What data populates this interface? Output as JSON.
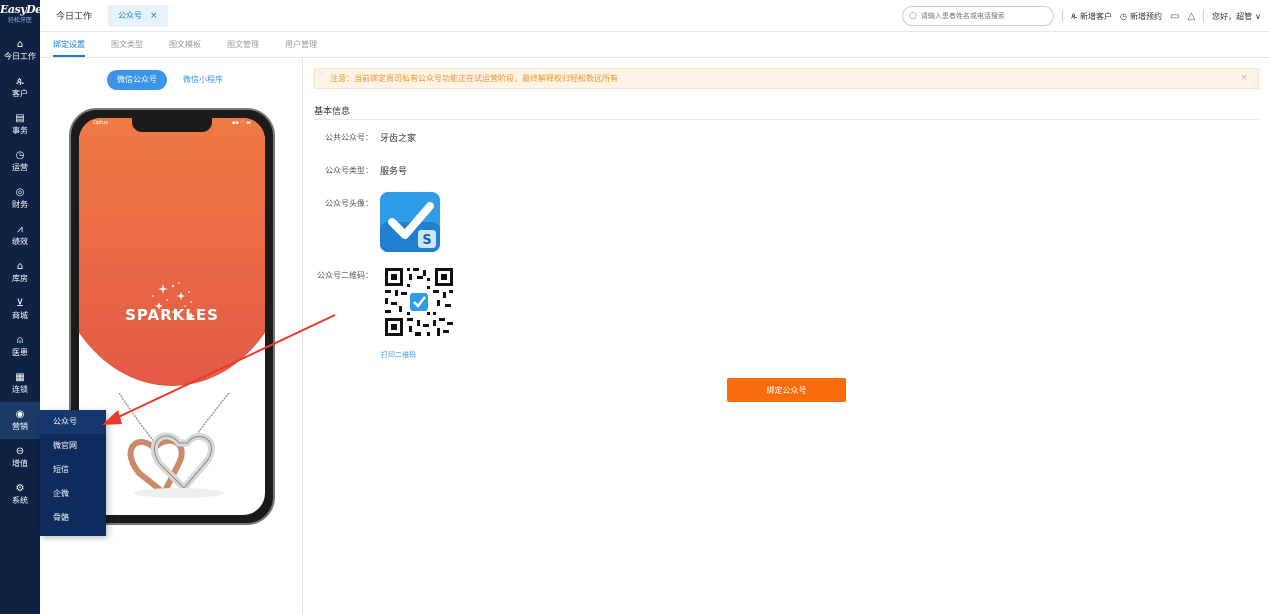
{
  "brand": {
    "name": "EasyDent",
    "subtitle": "轻松牙医"
  },
  "sidebar": {
    "items": [
      {
        "label": "今日工作",
        "icon": "home-icon"
      },
      {
        "label": "客户",
        "icon": "user-icon"
      },
      {
        "label": "事务",
        "icon": "task-icon"
      },
      {
        "label": "运营",
        "icon": "clock-icon"
      },
      {
        "label": "财务",
        "icon": "money-icon"
      },
      {
        "label": "绩效",
        "icon": "chart-icon"
      },
      {
        "label": "库房",
        "icon": "warehouse-icon"
      },
      {
        "label": "商城",
        "icon": "cart-icon"
      },
      {
        "label": "医患",
        "icon": "doctor-patient-icon"
      },
      {
        "label": "连锁",
        "icon": "chain-icon"
      },
      {
        "label": "营销",
        "icon": "marketing-icon"
      },
      {
        "label": "增值",
        "icon": "value-added-icon"
      },
      {
        "label": "系统",
        "icon": "gear-icon"
      }
    ],
    "flyout": [
      "公众号",
      "微官网",
      "短信",
      "企微",
      "骨骼"
    ]
  },
  "topbar": {
    "home_tab": "今日工作",
    "active_tab": "公众号",
    "close_glyph": "×",
    "search_placeholder": "请输入患者姓名或电话搜索",
    "add_customer": "新增客户",
    "add_appointment": "新增预约",
    "greeting": "您好，超管"
  },
  "subtabs": [
    "绑定设置",
    "图文类型",
    "图文模板",
    "图文管理",
    "用户管理"
  ],
  "preview": {
    "switch_official": "微信公众号",
    "switch_mini": "微信小程序",
    "carrier": "Optus",
    "status_right": "▪▪ ◠ ▬",
    "brand_text": "SPARKLES"
  },
  "notice": {
    "text": "注意：当前绑定贵司私有公众号功能正在试运营阶段，最终解释权归轻松数远所有",
    "close": "×"
  },
  "basic_info": {
    "title": "基本信息",
    "account_label": "公共公众号：",
    "account_value": "牙齿之家",
    "type_label": "公众号类型：",
    "type_value": "服务号",
    "avatar_label": "公众号头像：",
    "qr_label": "公众号二维码：",
    "print_qr": "打印二维码",
    "bind_button": "绑定公众号"
  },
  "colors": {
    "sidebar_bg": "#0f2244",
    "accent": "#1a7bd6",
    "bind_button": "#fa6b0c",
    "notice_text": "#e8962a",
    "annotation_arrow": "#e8392c"
  }
}
